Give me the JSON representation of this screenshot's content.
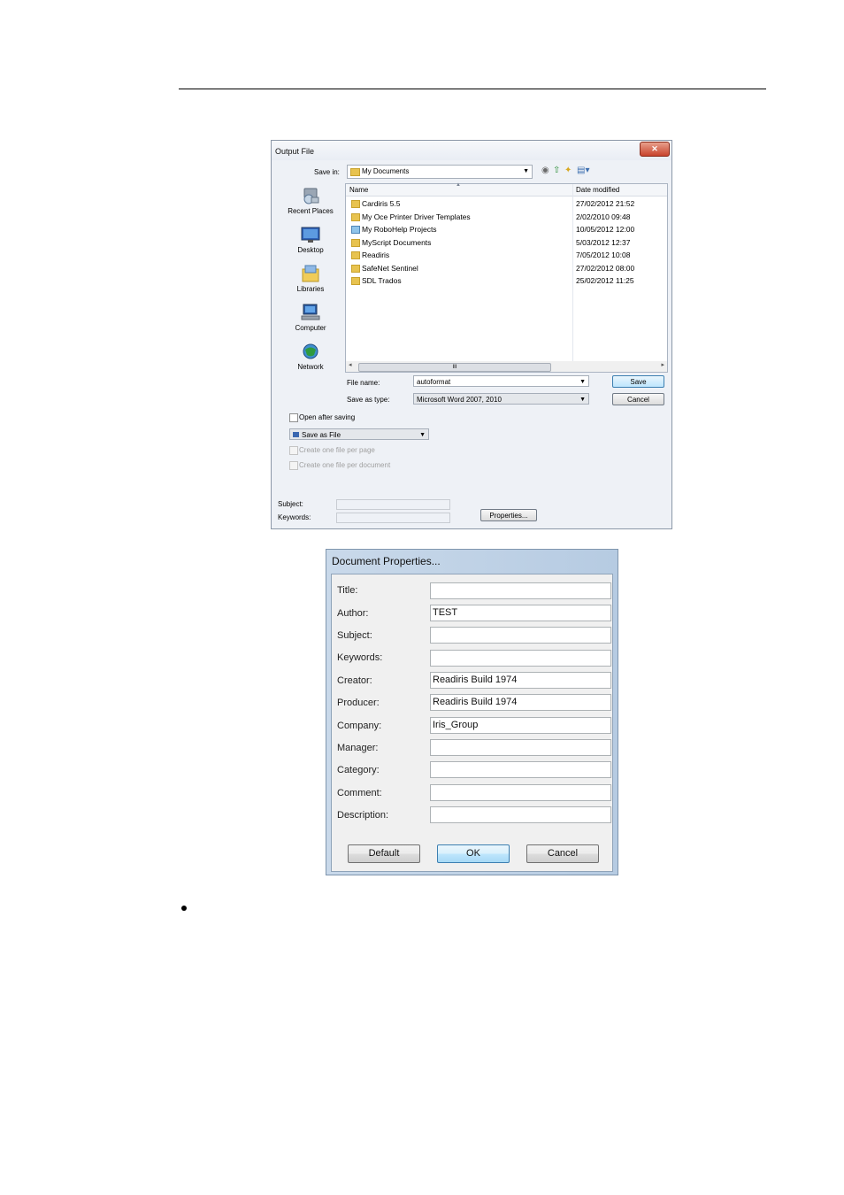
{
  "output_file": {
    "title": "Output File",
    "close_glyph": "✕",
    "save_in_label": "Save in:",
    "save_in_value": "My Documents",
    "places": [
      "Recent Places",
      "Desktop",
      "Libraries",
      "Computer",
      "Network"
    ],
    "columns": {
      "name": "Name",
      "date": "Date modified"
    },
    "files": [
      {
        "name": "Cardiris 5.5",
        "date": "27/02/2012 21:52"
      },
      {
        "name": "My Oce Printer Driver Templates",
        "date": "2/02/2010 09:48"
      },
      {
        "name": "My RoboHelp Projects",
        "date": "10/05/2012 12:00"
      },
      {
        "name": "MyScript Documents",
        "date": "5/03/2012 12:37"
      },
      {
        "name": "Readiris",
        "date": "7/05/2012 10:08"
      },
      {
        "name": "SafeNet Sentinel",
        "date": "27/02/2012 08:00"
      },
      {
        "name": "SDL Trados",
        "date": "25/02/2012 11:25"
      }
    ],
    "scroll_grip": "III",
    "file_name_label": "File name:",
    "file_name_value": "autoformat",
    "save_as_type_label": "Save as type:",
    "save_as_type_value": "Microsoft Word 2007, 2010",
    "save_button": "Save",
    "cancel_button": "Cancel",
    "open_after_saving": "Open after saving",
    "save_mode_value": "Save as File",
    "one_file_per_page": "Create one file per page",
    "one_file_per_document": "Create one file per document",
    "subject_label": "Subject:",
    "keywords_label": "Keywords:",
    "properties_button": "Properties..."
  },
  "document_properties": {
    "title": "Document Properties...",
    "fields": [
      {
        "label": "Title:",
        "value": ""
      },
      {
        "label": "Author:",
        "value": "TEST"
      },
      {
        "label": "Subject:",
        "value": ""
      },
      {
        "label": "Keywords:",
        "value": ""
      },
      {
        "label": "Creator:",
        "value": "Readiris Build 1974"
      },
      {
        "label": "Producer:",
        "value": "Readiris Build 1974"
      },
      {
        "label": "Company:",
        "value": "Iris_Group"
      },
      {
        "label": "Manager:",
        "value": ""
      },
      {
        "label": "Category:",
        "value": ""
      },
      {
        "label": "Comment:",
        "value": ""
      },
      {
        "label": "Description:",
        "value": ""
      }
    ],
    "default_button": "Default",
    "ok_button": "OK",
    "cancel_button": "Cancel"
  }
}
